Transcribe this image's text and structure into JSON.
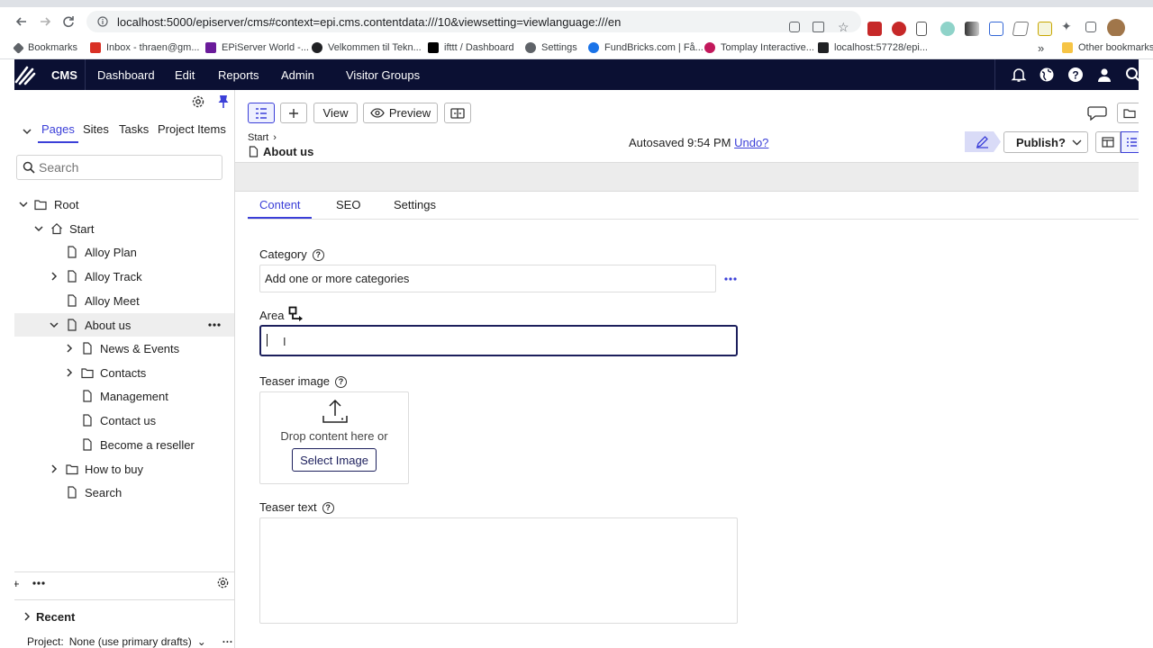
{
  "browser": {
    "url": "localhost:5000/episerver/cms#context=epi.cms.contentdata:///10&viewsetting=viewlanguage:///en",
    "bookmarks": [
      {
        "label": "Bookmarks",
        "color": "#5f6368"
      },
      {
        "label": "Inbox - thraen@gm...",
        "color": "#d93025"
      },
      {
        "label": "EPiServer World -...",
        "color": "#6a1b9a"
      },
      {
        "label": "Velkommen til Tekn...",
        "color": "#202124"
      },
      {
        "label": "ifttt / Dashboard",
        "color": "#000000"
      },
      {
        "label": "Settings",
        "color": "#5f6368"
      },
      {
        "label": "FundBricks.com | Få...",
        "color": "#1a73e8"
      },
      {
        "label": "Tomplay Interactive...",
        "color": "#c2185b"
      },
      {
        "label": "localhost:57728/epi...",
        "color": "#202124"
      }
    ],
    "more_bookmarks": "»",
    "other_bookmarks": "Other bookmarks"
  },
  "header": {
    "brand": "CMS",
    "nav": [
      "Dashboard",
      "Edit",
      "Reports",
      "Admin",
      "Visitor Groups"
    ]
  },
  "left": {
    "tabs": [
      "Pages",
      "Sites",
      "Tasks",
      "Project Items"
    ],
    "search_placeholder": "Search",
    "tree": [
      {
        "label": "Root",
        "icon": "folder-icon",
        "level": 0,
        "expanded": true
      },
      {
        "label": "Start",
        "icon": "home-icon",
        "level": 1,
        "expanded": true
      },
      {
        "label": "Alloy Plan",
        "icon": "page-icon",
        "level": 2
      },
      {
        "label": "Alloy Track",
        "icon": "page-icon",
        "level": 2,
        "collapsed": true
      },
      {
        "label": "Alloy Meet",
        "icon": "page-icon",
        "level": 2
      },
      {
        "label": "About us",
        "icon": "page-icon",
        "level": 2,
        "expanded": true,
        "selected": true
      },
      {
        "label": "News & Events",
        "icon": "page-icon",
        "level": 3,
        "collapsed": true
      },
      {
        "label": "Contacts",
        "icon": "folder-icon",
        "level": 3,
        "collapsed": true
      },
      {
        "label": "Management",
        "icon": "page-icon",
        "level": 3
      },
      {
        "label": "Contact us",
        "icon": "page-icon",
        "level": 3
      },
      {
        "label": "Become a reseller",
        "icon": "page-icon",
        "level": 3
      },
      {
        "label": "How to buy",
        "icon": "folder-icon",
        "level": 2,
        "collapsed": true
      },
      {
        "label": "Search",
        "icon": "page-icon",
        "level": 2
      }
    ],
    "recent_label": "Recent",
    "project_label": "Project:",
    "project_value": "None (use primary drafts)"
  },
  "toolbar": {
    "view_label": "View",
    "preview_label": "Preview",
    "breadcrumb_parent": "Start",
    "page_title": "About us",
    "autosave_text": "Autosaved 9:54 PM",
    "undo_label": "Undo?",
    "publish_label": "Publish?"
  },
  "form": {
    "tabs": [
      "Content",
      "SEO",
      "Settings"
    ],
    "active_tab": "Content",
    "category_label": "Category",
    "category_value": "Add one or more categories",
    "area_label": "Area",
    "area_value": "",
    "teaser_image_label": "Teaser image",
    "drop_text": "Drop content here or",
    "select_image_label": "Select Image",
    "teaser_text_label": "Teaser text"
  },
  "colors": {
    "header_bg": "#0b1033",
    "accent": "#3b3fd8",
    "focus_border": "#1c1f5c"
  }
}
